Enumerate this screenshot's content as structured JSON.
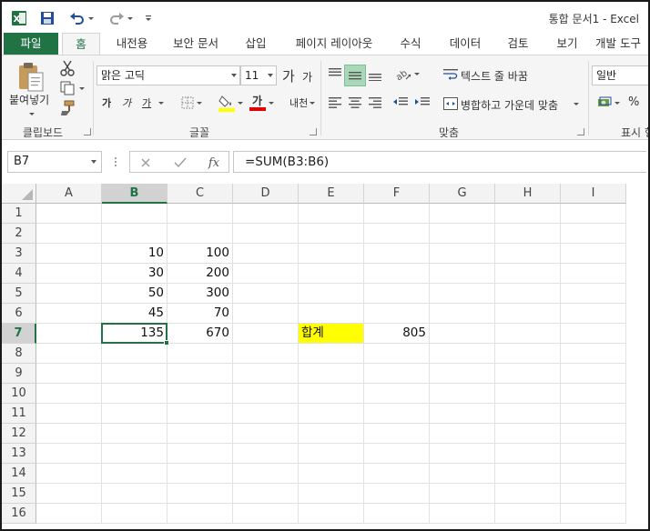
{
  "app": {
    "title": "통합 문서1 - Excel"
  },
  "ribbon_tabs": [
    {
      "label": "파일"
    },
    {
      "label": "홈"
    },
    {
      "label": "내전용"
    },
    {
      "label": "보안 문서"
    },
    {
      "label": "삽입"
    },
    {
      "label": "페이지 레이아웃"
    },
    {
      "label": "수식"
    },
    {
      "label": "데이터"
    },
    {
      "label": "검토"
    },
    {
      "label": "보기"
    },
    {
      "label": "개발 도구"
    }
  ],
  "clipboard": {
    "paste_label": "붙여넣기",
    "group_label": "클립보드"
  },
  "font": {
    "name": "맑은 고딕",
    "size": "11",
    "grow_label": "가",
    "shrink_label": "가",
    "bold_label": "가",
    "italic_label": "가",
    "underline_label": "가",
    "font_color_label": "가",
    "phonetic_label": "내천",
    "group_label": "글꼴",
    "fill_color": "#ffff00",
    "font_color": "#e00000"
  },
  "alignment": {
    "wrap_text_label": "텍스트 줄 바꿈",
    "merge_center_label": "병합하고 가운데 맞춤",
    "group_label": "맞춤"
  },
  "number": {
    "format": "일반",
    "percent_label": "%",
    "group_label": "표시 형"
  },
  "formula_bar": {
    "name_box": "B7",
    "fx_label": "fx",
    "formula": "=SUM(B3:B6)"
  },
  "grid": {
    "columns": [
      "A",
      "B",
      "C",
      "D",
      "E",
      "F",
      "G",
      "H",
      "I"
    ],
    "rows": [
      "1",
      "2",
      "3",
      "4",
      "5",
      "6",
      "7",
      "8",
      "9",
      "10",
      "11",
      "12",
      "13",
      "14",
      "15",
      "16"
    ],
    "selected_column": "B",
    "selected_row": "7",
    "cells": {
      "B3": "10",
      "C3": "100",
      "B4": "30",
      "C4": "200",
      "B5": "50",
      "C5": "300",
      "B6": "45",
      "C6": "70",
      "B7": "135",
      "C7": "670",
      "E7": "합계",
      "F7": "805"
    },
    "highlight_color": "#ffff00",
    "accent": "#217346"
  }
}
